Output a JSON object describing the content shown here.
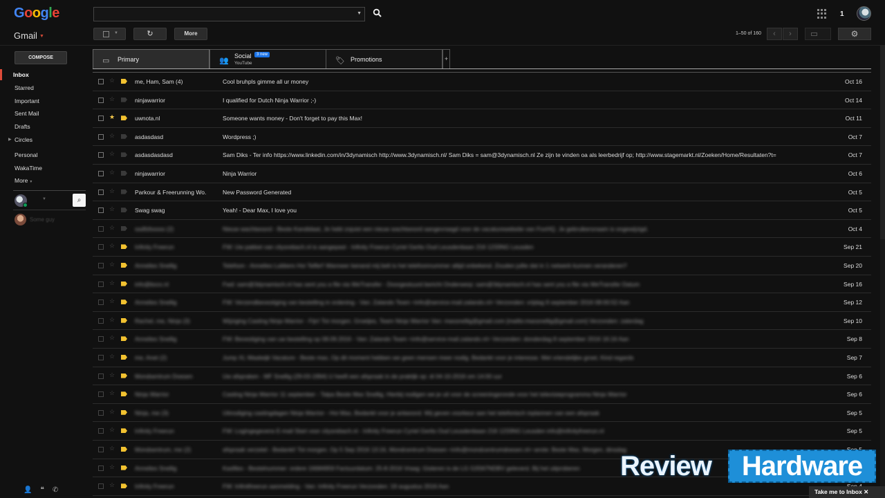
{
  "header": {
    "logo_letters": [
      {
        "ch": "G",
        "color": "#4285F4"
      },
      {
        "ch": "o",
        "color": "#EA4335"
      },
      {
        "ch": "o",
        "color": "#FBBC05"
      },
      {
        "ch": "g",
        "color": "#4285F4"
      },
      {
        "ch": "l",
        "color": "#34A853"
      },
      {
        "ch": "e",
        "color": "#EA4335"
      }
    ],
    "app_label": "Gmail",
    "search_value": "",
    "notification_count": "1"
  },
  "toolbar": {
    "more_label": "More",
    "pager_text": "1–50 of 160"
  },
  "sidebar": {
    "compose_label": "COMPOSE",
    "items": [
      {
        "label": "Inbox",
        "active": true
      },
      {
        "label": "Starred"
      },
      {
        "label": "Important"
      },
      {
        "label": "Sent Mail"
      },
      {
        "label": "Drafts"
      },
      {
        "label": "Circles"
      },
      {
        "label": "Personal"
      },
      {
        "label": "WakaTime"
      },
      {
        "label": "More"
      }
    ],
    "contact_name": "Some guy"
  },
  "tabs": {
    "primary": {
      "label": "Primary"
    },
    "social": {
      "label": "Social",
      "badge": "3 new",
      "sub": "YouTube"
    },
    "promotions": {
      "label": "Promotions"
    },
    "add_label": "+"
  },
  "messages": [
    {
      "sender": "me, Ham, Sam (4)",
      "subject": "Cool bruhpls gimme all ur money",
      "date": "Oct 16",
      "starred": false,
      "important": true,
      "blurred": false
    },
    {
      "sender": "ninjawarrior",
      "subject": "I qualified for Dutch Ninja Warrior ;-)",
      "date": "Oct 14",
      "starred": false,
      "important": false,
      "blurred": false
    },
    {
      "sender": "uwnota.nl",
      "subject": "Someone wants money - Don't forget to pay this Max!",
      "date": "Oct 11",
      "starred": true,
      "important": true,
      "blurred": false
    },
    {
      "sender": "asdasdasd",
      "subject": "Wordpress ;)",
      "date": "Oct 7",
      "starred": false,
      "important": false,
      "blurred": false
    },
    {
      "sender": "asdasdasdasd",
      "subject": "Sam Diks - Ter info https://www.linkedin.com/in/3dynamisch http://www.3dynamisch.nl/ Sam Diks = sam@3dynamisch.nl Ze zijn te vinden oa als leerbedrijf op; http://www.stagemarkt.nl/Zoeken/Home/Resultaten?t=",
      "date": "Oct 7",
      "starred": false,
      "important": false,
      "blurred": false
    },
    {
      "sender": "ninjawarrior",
      "subject": "Ninja Warrior",
      "date": "Oct 6",
      "starred": false,
      "important": false,
      "blurred": false
    },
    {
      "sender": "Parkour & Freerunning Wo.",
      "subject": "New Password Generated",
      "date": "Oct 5",
      "starred": false,
      "important": false,
      "blurred": false
    },
    {
      "sender": "Swag swag",
      "subject": "Yeah! - Dear Max, I love you",
      "date": "Oct 5",
      "starred": false,
      "important": false,
      "blurred": false
    },
    {
      "sender": "ssdfsfsssss (2)",
      "subject": "Nieuw wachtwoord - Beste Kandidaat, Je hebt zojuist een nieuw wachtwoord aangevraagd voor de vacaturewebsite van FoxHQ. Je gebruikersnaam is ongewijzigd.",
      "date": "Oct 4",
      "starred": false,
      "important": false,
      "blurred": true
    },
    {
      "sender": "Infinity Freerun",
      "subject": "FW: Uw pakket van citysrebach.nl is aangepast - Infinity Freerun Cyriel Gerits Oud Leusdenbaan 216 1233NG Leusden",
      "date": "Sep 21",
      "starred": false,
      "important": true,
      "blurred": true
    },
    {
      "sender": "Annelies Snellig",
      "subject": "Telefoon - Annelies Lubbers Hoi Telfie!! Wanneer kenand mij belt is het telefoonnummer altijd onbekend. Zouden jullie dat in 1 netwerk kunnen veranderen?",
      "date": "Sep 20",
      "starred": false,
      "important": true,
      "blurred": true
    },
    {
      "sender": "info@bxxx.nl",
      "subject": "Fwd: sam@3dynamisch.nl has sent you a file via WeTransfer - Doorgestuurd bericht Onderwerp: sam@3dynamisch.nl has sent you a file via WeTransfer Datum",
      "date": "Sep 16",
      "starred": false,
      "important": true,
      "blurred": true
    },
    {
      "sender": "Annelies Snellig",
      "subject": "FW: Verzendbevestiging van bestelling in ordening - Van: Zalando Team <info@service-mail.zalando.nl> Verzonden: vrijdag 9 september 2016 08:00:52 Aan",
      "date": "Sep 12",
      "starred": false,
      "important": true,
      "blurred": true
    },
    {
      "sender": "Rachel, me, Ninja (3)",
      "subject": "Wijziging Casting Ninja Warrior - Fijn! Tot morgen. Groetjes, Team Ninja Warrior Van: maxsnellig@gmail.com [mailto:maxsnellig@gmail.com] Verzonden: zaterdag",
      "date": "Sep 10",
      "starred": false,
      "important": true,
      "blurred": true
    },
    {
      "sender": "Annelies Snellig",
      "subject": "FW: Bevestiging van uw bestelling op 08.09.2016 - Van: Zalando Team <info@service-mail.zalando.nl> Verzonden: donderdag 8 september 2016 16:16 Aan",
      "date": "Sep 8",
      "starred": false,
      "important": true,
      "blurred": true
    },
    {
      "sender": "me, Anet (2)",
      "subject": "Jump XL Waalwijk Vacature - Beste max, Op dit moment hebben we geen mensen meer nodig. Bedankt voor je interesse. Met vriendelijke groet, Kind regards",
      "date": "Sep 7",
      "starred": false,
      "important": true,
      "blurred": true
    },
    {
      "sender": "Mondsentrum Doesen",
      "subject": "Uw afspraken - MF Snellig (29-03-1994) U heeft een afspraak in de praktijk op: di 04-10-2016 om 14:00 uur",
      "date": "Sep 6",
      "starred": false,
      "important": true,
      "blurred": true
    },
    {
      "sender": "Ninja Warrior",
      "subject": "Casting Ninja Warrior 11 september - Talpa Beste Max Snellig, Hierbij nodigen we je uit voor de screeningsronde voor het televisieprogramma Ninja Warrior",
      "date": "Sep 6",
      "starred": false,
      "important": true,
      "blurred": true
    },
    {
      "sender": "Ninja, me (3)",
      "subject": "Uitnodiging castingdagen Ninja Warrior - Hoi Max, Bedankt voor je antwoord. Wij geven voorkeur aan het telefonisch inplannen van een afspraak",
      "date": "Sep 5",
      "starred": false,
      "important": true,
      "blurred": true
    },
    {
      "sender": "Infinity Freerun",
      "subject": "FW: Logingegevens E-mail Start voor citysrebach.nl - Infinity Freerun Cyriel Gerits Oud Leusdenbaan 216 1233NG Leusden info@infinityfreerun.nl",
      "date": "Sep 5",
      "starred": false,
      "important": true,
      "blurred": true
    },
    {
      "sender": "Mondsentrum, me (2)",
      "subject": "afspraak verzetel - Bedankt! Tot morgen. Op 5 Sep 2016 13:16, Mondcentrum Doesen <info@mondcentrumdoesen.nl> wrote: Beste Max, Morgen, dinsdag",
      "date": "Sep 5",
      "starred": false,
      "important": true,
      "blurred": true
    },
    {
      "sender": "Annelies Snellig",
      "subject": "Kasfiles - Bestelnummer: ordere 16684959 Factuurdatum: 25-8-2016 Vraag: Gisteren is de LG G3S67NDBV geleverd. Bij het uitproberen",
      "date": "Sep 5",
      "starred": false,
      "important": true,
      "blurred": true
    },
    {
      "sender": "Infinity Freerun",
      "subject": "FW: Infinitfreerun aanmelding - Van: Infinity Freerun Verzonden: 19 augustus 2016 Aan",
      "date": "Sep 4",
      "starred": false,
      "important": true,
      "blurred": true
    }
  ],
  "watermark": {
    "word1": "Review",
    "word2": "Hardware"
  },
  "footer": {
    "take_me_label": "Take me to Inbox ✕"
  }
}
